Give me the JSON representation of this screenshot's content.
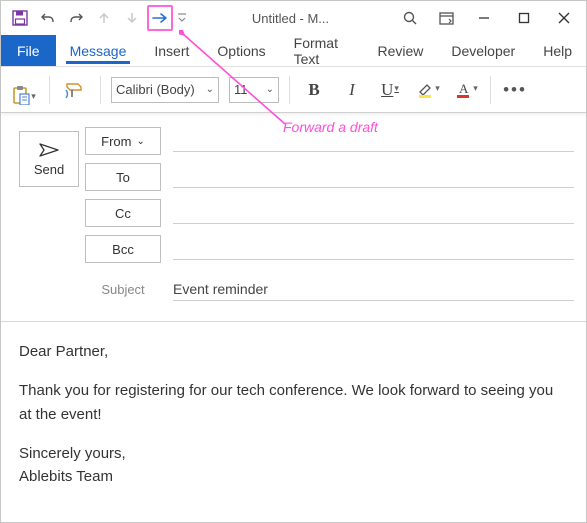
{
  "title": "Untitled  -  M...",
  "quickAccess": {
    "save": "save-icon",
    "undo": "undo-icon",
    "redo": "redo-icon",
    "prev": "prev-icon",
    "next": "next-icon",
    "forward": "forward-icon"
  },
  "tabs": {
    "file": "File",
    "items": [
      "Message",
      "Insert",
      "Options",
      "Format Text",
      "Review",
      "Developer",
      "Help"
    ],
    "activeIndex": 0
  },
  "ribbon": {
    "font": "Calibri (Body)",
    "size": "11"
  },
  "compose": {
    "send": "Send",
    "from": "From",
    "to": "To",
    "cc": "Cc",
    "bcc": "Bcc",
    "subjectLabel": "Subject",
    "subject": "Event reminder"
  },
  "body": {
    "greeting": "Dear Partner,",
    "para1": "Thank you for registering for our tech conference. We look forward to seeing you at the event!",
    "sign1": "Sincerely yours,",
    "sign2": "Ablebits Team"
  },
  "annotation": "Forward a draft"
}
